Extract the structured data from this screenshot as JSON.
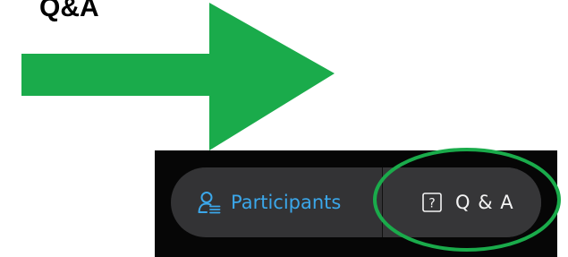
{
  "annotation": {
    "title": "Q&A",
    "arrow_color": "#1aab4b",
    "ring_color": "#1aab4b"
  },
  "toolbar": {
    "participants": {
      "label": "Participants",
      "icon": "participants-icon",
      "color": "#3ba7ea"
    },
    "qa": {
      "label": "Q & A",
      "icon": "question-box-icon",
      "color": "#f4f4f4"
    }
  }
}
